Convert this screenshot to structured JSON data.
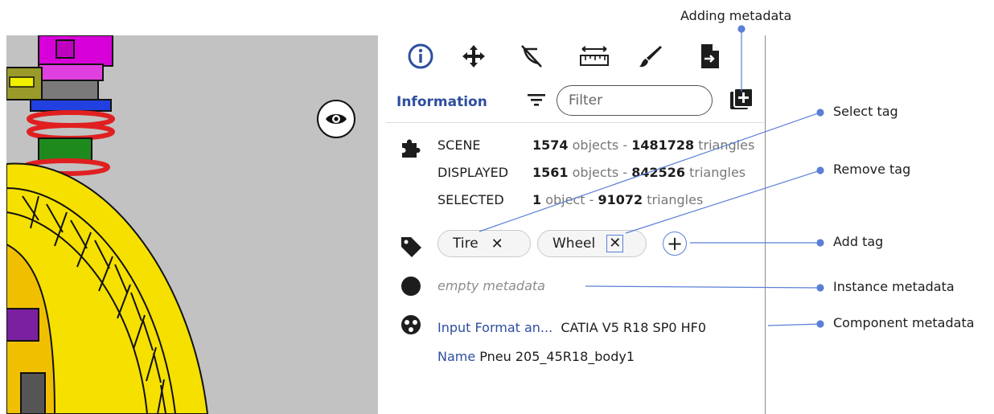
{
  "annotations": {
    "adding_metadata": "Adding metadata",
    "select_tag": "Select tag",
    "remove_tag": "Remove tag",
    "add_tag": "Add tag",
    "instance_metadata": "Instance metadata",
    "component_metadata": "Component metadata"
  },
  "toolbar": {
    "tools": [
      "info-icon",
      "move-icon",
      "hide-icon",
      "measure-icon",
      "paint-icon",
      "export-icon"
    ]
  },
  "panel": {
    "title": "Information",
    "filter_placeholder": "Filter",
    "stats": [
      {
        "label": "SCENE",
        "objects": "1574",
        "objects_word": "objects -",
        "triangles": "1481728",
        "triangles_word": "triangles"
      },
      {
        "label": "DISPLAYED",
        "objects": "1561",
        "objects_word": "objects -",
        "triangles": "842526",
        "triangles_word": "triangles"
      },
      {
        "label": "SELECTED",
        "objects": "1",
        "objects_word": "object -",
        "triangles": "91072",
        "triangles_word": "triangles"
      }
    ],
    "tags": [
      {
        "label": "Tire",
        "remove": "✕"
      },
      {
        "label": "Wheel",
        "remove": "✕"
      }
    ],
    "add_tag": "+",
    "instance_metadata": "empty metadata",
    "component": [
      {
        "label": "Input Format an...",
        "value": "CATIA V5 R18 SP0 HF0"
      },
      {
        "label": "Name",
        "value": "Pneu 205_45R18_body1"
      }
    ]
  },
  "colors": {
    "accent": "#2e4ea0",
    "annotation": "#5b7fd6",
    "viewport_bg": "#c2c2c2",
    "tire": "#f5e000",
    "spring": "#e02020",
    "hub": "#e000e0"
  }
}
